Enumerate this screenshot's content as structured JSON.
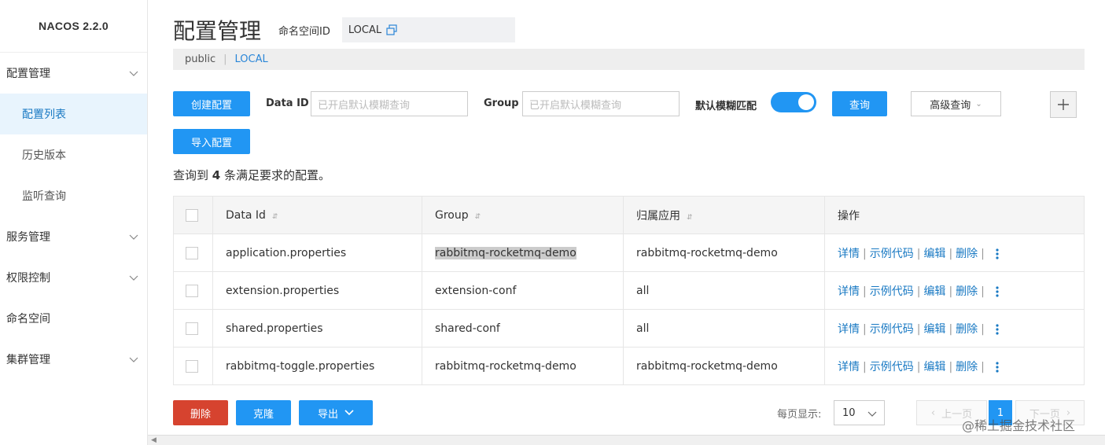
{
  "brand": "NACOS 2.2.0",
  "sidebar": {
    "items": [
      {
        "label": "配置管理",
        "expandable": true
      },
      {
        "label": "配置列表",
        "active": true
      },
      {
        "label": "历史版本"
      },
      {
        "label": "监听查询"
      },
      {
        "label": "服务管理",
        "expandable": true
      },
      {
        "label": "权限控制",
        "expandable": true
      },
      {
        "label": "命名空间"
      },
      {
        "label": "集群管理",
        "expandable": true
      }
    ]
  },
  "header": {
    "title": "配置管理",
    "namespace_label": "命名空间ID",
    "namespace_value": "LOCAL"
  },
  "breadcrumb": {
    "public": "public",
    "separator": "|",
    "local": "LOCAL"
  },
  "toolbar": {
    "create_label": "创建配置",
    "import_label": "导入配置",
    "data_id_label": "Data ID",
    "data_id_placeholder": "已开启默认模糊查询",
    "group_label": "Group",
    "group_placeholder": "已开启默认模糊查询",
    "fuzzy_label": "默认模糊匹配",
    "fuzzy_on": true,
    "query_label": "查询",
    "advanced_label": "高级查询"
  },
  "summary": {
    "prefix": "查询到 ",
    "count": "4",
    "suffix": " 条满足要求的配置。"
  },
  "table": {
    "headers": [
      "Data Id",
      "Group",
      "归属应用",
      "操作"
    ],
    "rows": [
      {
        "data_id": "application.properties",
        "group": "rabbitmq-rocketmq-demo",
        "app": "rabbitmq-rocketmq-demo"
      },
      {
        "data_id": "extension.properties",
        "group": "extension-conf",
        "app": "all"
      },
      {
        "data_id": "shared.properties",
        "group": "shared-conf",
        "app": "all"
      },
      {
        "data_id": "rabbitmq-toggle.properties",
        "group": "rabbitmq-rocketmq-demo",
        "app": "rabbitmq-rocketmq-demo"
      }
    ],
    "ops": {
      "detail": "详情",
      "sample": "示例代码",
      "edit": "编辑",
      "delete": "删除",
      "sep": "|"
    }
  },
  "footer": {
    "delete_label": "删除",
    "clone_label": "克隆",
    "export_label": "导出",
    "page_size_label": "每页显示:",
    "page_size": "10",
    "prev_label": "上一页",
    "current_page": "1",
    "next_label": "下一页"
  },
  "watermark": "@稀土掘金技术社区",
  "colors": {
    "primary": "#2196f3",
    "danger": "#d6432f",
    "link": "#1979c3"
  }
}
